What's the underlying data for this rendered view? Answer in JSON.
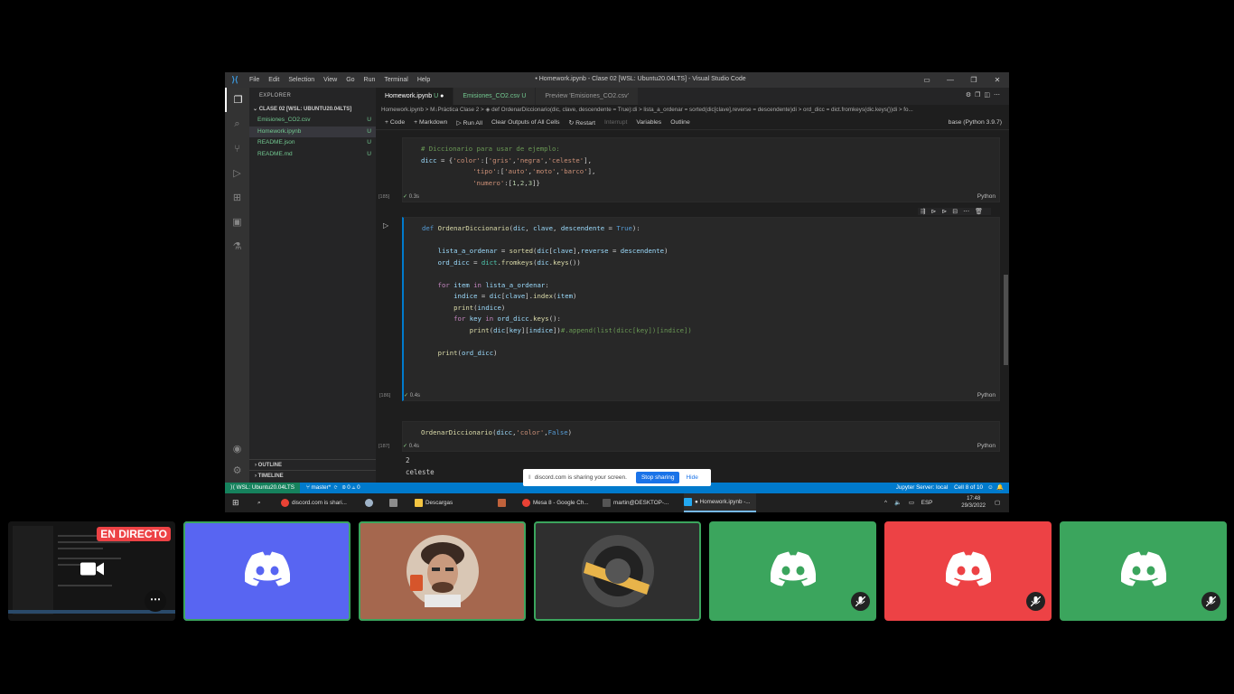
{
  "vscode": {
    "logo": "vscode-logo",
    "menu": [
      "File",
      "Edit",
      "Selection",
      "View",
      "Go",
      "Run",
      "Terminal",
      "Help"
    ],
    "window_title": "• Homework.ipynb - Clase 02 [WSL: Ubuntu20.04LTS] - Visual Studio Code",
    "explorer": {
      "header": "EXPLORER",
      "folder": "CLASE 02 [WSL: UBUNTU20.04LTS]",
      "files": [
        {
          "name": "Emisiones_CO2.csv",
          "status": "U"
        },
        {
          "name": "Homework.ipynb",
          "status": "U"
        },
        {
          "name": "README.json",
          "status": "U"
        },
        {
          "name": "README.md",
          "status": "U"
        }
      ],
      "outline": "OUTLINE",
      "timeline": "TIMELINE"
    },
    "tabs": [
      {
        "label": "Homework.ipynb",
        "suffix": "U",
        "dirty": "●"
      },
      {
        "label": "Emisiones_CO2.csv",
        "suffix": "U"
      },
      {
        "label": "Preview 'Emisiones_CO2.csv'"
      }
    ],
    "breadcrumb": "Homework.ipynb > M↓Práctica Clase 2 > ◈ def OrdenarDiccionario(dic, clave, descendente = True):di > lista_a_ordenar = sorted(dic[clave],reverse = descendente)di > ord_dicc = dict.fromkeys(dic.keys())di > fo...",
    "notebook_toolbar": {
      "code": "+ Code",
      "markdown": "+ Markdown",
      "run_all": "▷ Run All",
      "clear": "Clear Outputs of All Cells",
      "restart": "↻ Restart",
      "interrupt": "Interrupt",
      "variables": "Variables",
      "outline": "Outline",
      "kernel": "base (Python 3.9.7)"
    },
    "cells": [
      {
        "exec": "[185]",
        "time": "0.3s",
        "lang": "Python",
        "lines": [
          "# Diccionario para usar de ejemplo:",
          "dicc = {'color':['gris','negra','celeste'],",
          "             'tipo':['auto','moto','barco'],",
          "             'numero':[1,2,3]}"
        ]
      },
      {
        "exec": "[186]",
        "time": "0.4s",
        "lang": "Python",
        "lines": [
          "def OrdenarDiccionario(dic, clave, descendente = True):",
          "",
          "    lista_a_ordenar = sorted(dic[clave],reverse = descendente)",
          "    ord_dicc = dict.fromkeys(dic.keys())",
          "",
          "    for item in lista_a_ordenar:",
          "        indice = dic[clave].index(item)",
          "        print(indice)",
          "        for key in ord_dicc.keys():",
          "            print(dic[key][indice])#.append(list(dicc[key])[indice])",
          "",
          "    print(ord_dicc)"
        ]
      },
      {
        "exec": "[187]",
        "time": "0.4s",
        "lang": "Python",
        "lines": [
          "OrdenarDiccionario(dicc,'color',False)"
        ],
        "outputs": [
          "2",
          "celeste"
        ]
      }
    ],
    "statusbar": {
      "remote": "WSL: Ubuntu20.04LTS",
      "branch": "master*",
      "sync": "⟳",
      "problems": "⊗ 0 ⚠ 0",
      "jupyter": "Jupyter Server: local",
      "cell": "Cell 8 of 10"
    }
  },
  "share_banner": {
    "text": "discord.com is sharing your screen.",
    "stop": "Stop sharing",
    "hide": "Hide"
  },
  "taskbar": {
    "items": [
      {
        "label": "discord.com is shari...",
        "icon": "chrome-icon"
      },
      {
        "label": "",
        "icon": "steam-icon"
      },
      {
        "label": "",
        "icon": "explorer-icon"
      },
      {
        "label": "Descargas",
        "icon": "folder-icon"
      },
      {
        "label": "",
        "icon": "app-icon"
      },
      {
        "label": "Mesa 8 - Google Ch...",
        "icon": "chrome-icon"
      },
      {
        "label": "martin@DESKTOP-...",
        "icon": "terminal-icon"
      },
      {
        "label": "● Homework.ipynb -...",
        "icon": "vscode-icon"
      }
    ],
    "lang": "ESP",
    "time": "17:48",
    "date": "29/3/2022"
  },
  "discord": {
    "live_label": "EN DIRECTO",
    "tiles": [
      {
        "kind": "stream",
        "color": "#111111"
      },
      {
        "kind": "avatar",
        "color": "#5865f2",
        "speaking": "yes"
      },
      {
        "kind": "camera",
        "color": "#a5674e",
        "speaking": "yes"
      },
      {
        "kind": "badge",
        "color": "#2f2f2f",
        "speaking": "yes"
      },
      {
        "kind": "avatar",
        "color": "#3ba55d",
        "muted": "yes"
      },
      {
        "kind": "avatar",
        "color": "#ed4245",
        "muted": "yes"
      },
      {
        "kind": "avatar",
        "color": "#3ba55d",
        "muted": "yes"
      }
    ]
  },
  "colors": {
    "accent": "#007acc",
    "discord_blurple": "#5865f2",
    "discord_green": "#3ba55d",
    "discord_red": "#ed4245"
  }
}
